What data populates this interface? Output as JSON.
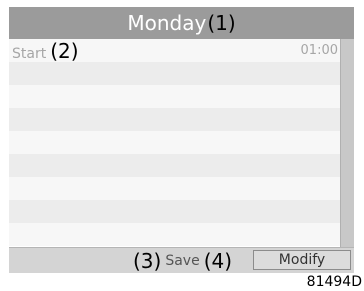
{
  "title": {
    "day": "Monday",
    "annotation": "(1)"
  },
  "list": {
    "first_row": {
      "label": "Start",
      "annotation": "(2)",
      "value": "01:00"
    }
  },
  "bottom": {
    "save_annotation": "(3)",
    "save_label": "Save",
    "modify_annotation": "(4)",
    "modify_label": "Modify"
  },
  "reference_code": "81494D"
}
